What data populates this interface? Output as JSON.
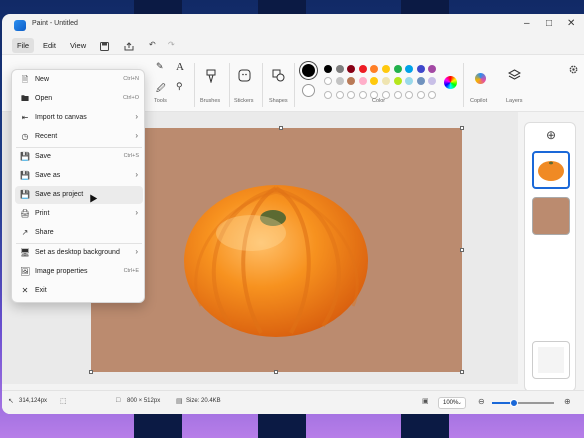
{
  "window": {
    "title": "Paint - Untitled"
  },
  "menubar": {
    "file": "File",
    "edit": "Edit",
    "view": "View"
  },
  "ribbon": {
    "tools_label": "Tools",
    "brushes_label": "Brushes",
    "stickers_label": "Stickers",
    "shapes_label": "Shapes",
    "color_label": "Color",
    "copilot_label": "Copilot",
    "layers_label": "Layers",
    "palette_row1": [
      "#000000",
      "#7f7f7f",
      "#880015",
      "#ed1c24",
      "#ff7f27",
      "#ffc90e",
      "#22b14c",
      "#00a2e8",
      "#3f48cc",
      "#a349a4"
    ],
    "palette_row2": [
      "#ffffff",
      "#c3c3c3",
      "#b97a57",
      "#ffaec9",
      "#ffc90e",
      "#efe4b0",
      "#b5e61d",
      "#99d9ea",
      "#7092be",
      "#c8bfe7"
    ],
    "primary_color": "#000000",
    "secondary_color": "#ffffff"
  },
  "file_menu": {
    "items": [
      {
        "label": "New",
        "shortcut": "Ctrl+N"
      },
      {
        "label": "Open",
        "shortcut": "Ctrl+O"
      },
      {
        "label": "Import to canvas"
      },
      {
        "label": "Recent"
      },
      {
        "label": "Save",
        "shortcut": "Ctrl+S"
      },
      {
        "label": "Save as"
      },
      {
        "label": "Save as project"
      },
      {
        "label": "Print"
      },
      {
        "label": "Share"
      },
      {
        "label": "Set as desktop background"
      },
      {
        "label": "Image properties",
        "shortcut": "Ctrl+E"
      },
      {
        "label": "Exit"
      }
    ]
  },
  "status": {
    "position": "314,124px",
    "dimensions": "800 × 512px",
    "size": "Size: 20.4KB",
    "zoom": "100%",
    "zoom_level": 0.35
  },
  "colors": {
    "accent": "#1a68d8",
    "canvas_bg": "#bb8b6f",
    "pumpkin": "#f08a24"
  }
}
